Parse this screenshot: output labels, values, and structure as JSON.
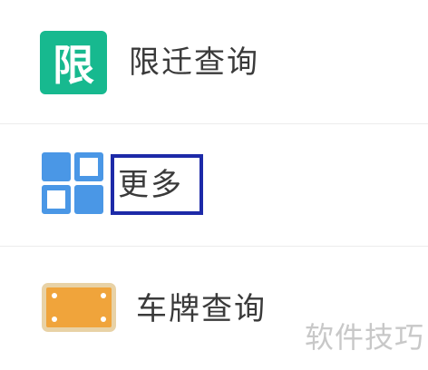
{
  "menu": {
    "items": [
      {
        "label": "限迁查询",
        "icon": "limit-icon",
        "icon_text": "限",
        "icon_color": "#17b98f"
      },
      {
        "label": "更多",
        "icon": "grid-icon",
        "icon_color": "#4a97e6",
        "highlighted": true
      },
      {
        "label": "车牌查询",
        "icon": "license-plate-icon",
        "icon_color": "#f0a43b"
      }
    ]
  },
  "watermark": "软件技巧",
  "colors": {
    "highlight_box": "#1d2aa8",
    "divider": "#ececec"
  }
}
